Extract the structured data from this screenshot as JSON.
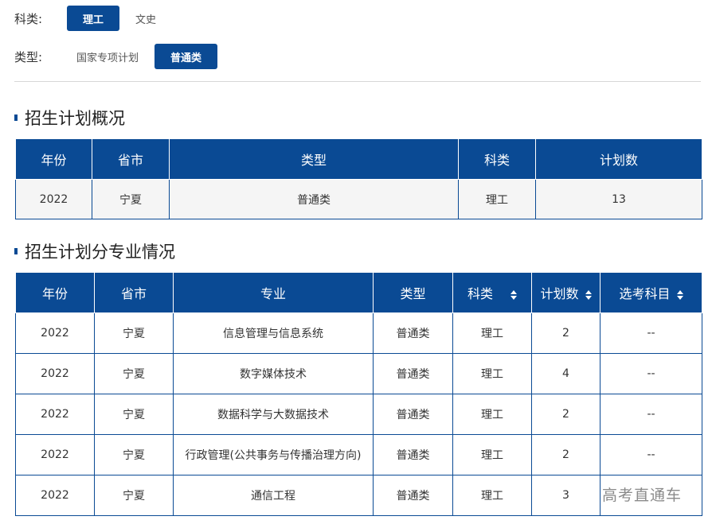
{
  "filters": {
    "subject": {
      "label": "科类:",
      "options": [
        "理工",
        "文史"
      ],
      "selected": "理工"
    },
    "type": {
      "label": "类型:",
      "options": [
        "国家专项计划",
        "普通类"
      ],
      "selected": "普通类"
    }
  },
  "overview": {
    "title": "招生计划概况",
    "headers": [
      "年份",
      "省市",
      "类型",
      "科类",
      "计划数"
    ],
    "rows": [
      [
        "2022",
        "宁夏",
        "普通类",
        "理工",
        "13"
      ]
    ]
  },
  "majors": {
    "title": "招生计划分专业情况",
    "headers": [
      "年份",
      "省市",
      "专业",
      "类型",
      "科类",
      "计划数",
      "选考科目"
    ],
    "sortable": [
      false,
      false,
      false,
      false,
      true,
      true,
      true
    ],
    "rows": [
      [
        "2022",
        "宁夏",
        "信息管理与信息系统",
        "普通类",
        "理工",
        "2",
        "--"
      ],
      [
        "2022",
        "宁夏",
        "数字媒体技术",
        "普通类",
        "理工",
        "4",
        "--"
      ],
      [
        "2022",
        "宁夏",
        "数据科学与大数据技术",
        "普通类",
        "理工",
        "2",
        "--"
      ],
      [
        "2022",
        "宁夏",
        "行政管理(公共事务与传播治理方向)",
        "普通类",
        "理工",
        "2",
        "--"
      ],
      [
        "2022",
        "宁夏",
        "通信工程",
        "普通类",
        "理工",
        "3",
        ""
      ]
    ]
  },
  "watermark": "高考直通车",
  "colors": {
    "accent": "#0a4a94"
  }
}
